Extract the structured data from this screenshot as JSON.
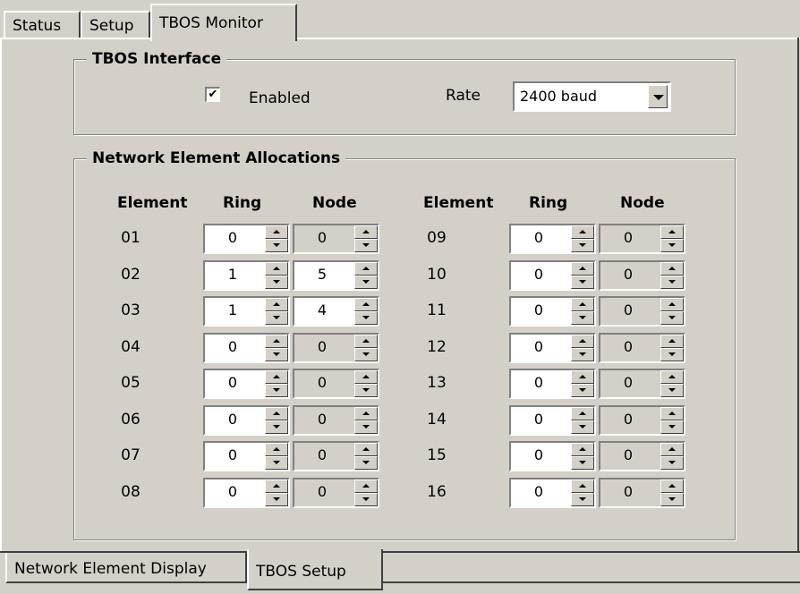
{
  "tabs_top": [
    {
      "label": "Status"
    },
    {
      "label": "Setup"
    },
    {
      "label": "TBOS Monitor"
    }
  ],
  "tbos_interface": {
    "title": "TBOS Interface",
    "enabled_label": "Enabled",
    "enabled_checked": true,
    "check_glyph": "✔",
    "rate_label": "Rate",
    "rate_value": "2400 baud"
  },
  "allocations": {
    "title": "Network Element Allocations",
    "headers": {
      "element": "Element",
      "ring": "Ring",
      "node": "Node"
    },
    "left": [
      {
        "element": "01",
        "ring": "0",
        "node": "0",
        "node_enabled": false
      },
      {
        "element": "02",
        "ring": "1",
        "node": "5",
        "node_enabled": true
      },
      {
        "element": "03",
        "ring": "1",
        "node": "4",
        "node_enabled": true
      },
      {
        "element": "04",
        "ring": "0",
        "node": "0",
        "node_enabled": false
      },
      {
        "element": "05",
        "ring": "0",
        "node": "0",
        "node_enabled": false
      },
      {
        "element": "06",
        "ring": "0",
        "node": "0",
        "node_enabled": false
      },
      {
        "element": "07",
        "ring": "0",
        "node": "0",
        "node_enabled": false
      },
      {
        "element": "08",
        "ring": "0",
        "node": "0",
        "node_enabled": false
      }
    ],
    "right": [
      {
        "element": "09",
        "ring": "0",
        "node": "0",
        "node_enabled": false
      },
      {
        "element": "10",
        "ring": "0",
        "node": "0",
        "node_enabled": false
      },
      {
        "element": "11",
        "ring": "0",
        "node": "0",
        "node_enabled": false
      },
      {
        "element": "12",
        "ring": "0",
        "node": "0",
        "node_enabled": false
      },
      {
        "element": "13",
        "ring": "0",
        "node": "0",
        "node_enabled": false
      },
      {
        "element": "14",
        "ring": "0",
        "node": "0",
        "node_enabled": false
      },
      {
        "element": "15",
        "ring": "0",
        "node": "0",
        "node_enabled": false
      },
      {
        "element": "16",
        "ring": "0",
        "node": "0",
        "node_enabled": false
      }
    ]
  },
  "tabs_bottom": [
    {
      "label": "Network Element Display"
    },
    {
      "label": "TBOS Setup"
    }
  ]
}
